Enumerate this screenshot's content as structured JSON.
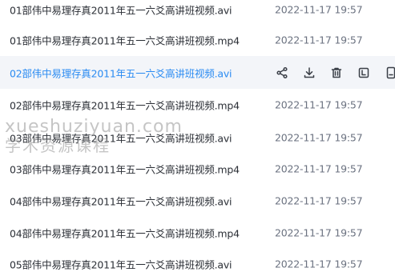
{
  "files": [
    {
      "name": "01部伟中易理存真2011年五一六爻高讲班视频.avi",
      "date": "2022-11-17 19:57"
    },
    {
      "name": "01部伟中易理存真2011年五一六爻高讲班视频.mp4",
      "date": "2022-11-17 19:57"
    },
    {
      "name": "02部伟中易理存真2011年五一六爻高讲班视频.avi",
      "date": ""
    },
    {
      "name": "02部伟中易理存真2011年五一六爻高讲班视频.mp4",
      "date": "2022-11-17 19:57"
    },
    {
      "name": "03部伟中易理存真2011年五一六爻高讲班视频.avi",
      "date": "2022-11-17 19:57"
    },
    {
      "name": "03部伟中易理存真2011年五一六爻高讲班视频.mp4",
      "date": "2022-11-17 19:57"
    },
    {
      "name": "04部伟中易理存真2011年五一六爻高讲班视频.avi",
      "date": "2022-11-17 19:57"
    },
    {
      "name": "04部伟中易理存真2011年五一六爻高讲班视频.mp4",
      "date": "2022-11-17 19:57"
    },
    {
      "name": "05部伟中易理存真2011年五一六爻高讲班视频.avi",
      "date": "2022-11-17 19:57"
    }
  ],
  "hovered_row_actions": [
    "share-icon",
    "download-icon",
    "delete-icon",
    "rename-icon",
    "more-icon"
  ],
  "watermark": {
    "line1": "xueshuziyuan.com",
    "line2": "学术资源课程"
  },
  "colors": {
    "active_name": "#2a8bf2",
    "active_row_bg": "#f3f5f9",
    "name_text": "#2b2f36",
    "date_text": "#6b7280"
  }
}
